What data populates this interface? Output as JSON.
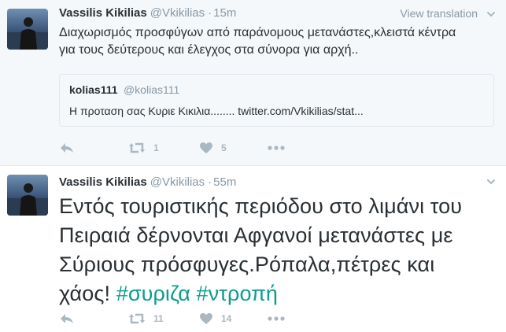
{
  "tweets": [
    {
      "fullname": "Vassilis Kikilias",
      "username": "@Vkikilias",
      "separator": "·",
      "time": "15m",
      "view_translation": "View translation",
      "text_line1": "Διαχωρισμός προσφύγων από παράνομους μετανάστες,κλειστά κέντρα",
      "text_line2": "για τους δεύτερους και έλεγχος στα σύνορα για αρχή..",
      "quote": {
        "fullname": "kolias111",
        "username": "@kolias111",
        "text": "Η προταση σας Κυριε Κικιλια........ twitter.com/Vkikilias/stat..."
      },
      "retweets": "1",
      "likes": "5",
      "icons": [
        "reply-icon",
        "retweet-icon",
        "heart-icon",
        "more-icon",
        "caret-down-icon"
      ]
    },
    {
      "fullname": "Vassilis Kikilias",
      "username": "@Vkikilias",
      "separator": "·",
      "time": "55m",
      "text_line1": "Εντός τουριστικής περιόδου στο λιμάνι του",
      "text_line2": "Πειραιά δέρνονται Αφγανοί μετανάστες με",
      "text_line3": "Σύριους πρόσφυγες.Ρόπαλα,πέτρες και",
      "text_line4_plain": "χάος! ",
      "hashtag1": "#συριζα",
      "hashtag2": "#ντροπή",
      "retweets": "11",
      "likes": "14",
      "icons": [
        "reply-icon",
        "retweet-icon",
        "heart-icon",
        "more-icon",
        "caret-down-icon"
      ]
    }
  ],
  "colors": {
    "meta": "#8899a6",
    "text": "#292f33",
    "hashtag": "#0b9c8f",
    "action": "#aab8c2"
  }
}
